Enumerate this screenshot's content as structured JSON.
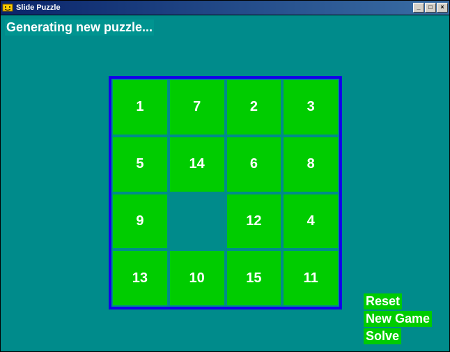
{
  "window": {
    "title": "Slide Puzzle"
  },
  "status_message": "Generating new puzzle...",
  "board": {
    "rows": 4,
    "cols": 4,
    "tiles": [
      "1",
      "7",
      "2",
      "3",
      "5",
      "14",
      "6",
      "8",
      "9",
      "",
      "12",
      "4",
      "13",
      "10",
      "15",
      "11"
    ]
  },
  "buttons": {
    "reset": "Reset",
    "new_game": "New Game",
    "solve": "Solve"
  },
  "colors": {
    "background": "#008b8b",
    "tile": "#00cc00",
    "border": "#1200e8",
    "text": "#ffffff"
  }
}
